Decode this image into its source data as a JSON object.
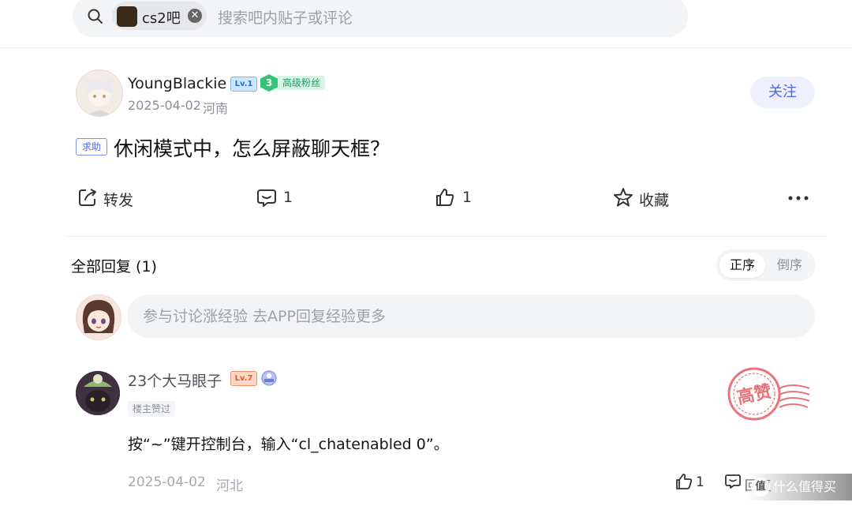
{
  "search": {
    "forum_chip": "cs2吧",
    "placeholder": "搜索吧内贴子或评论",
    "clear_glyph": "✕"
  },
  "post": {
    "author": "YoungBlackie",
    "level": "Lv.1",
    "fan_level": "3",
    "fan_title": "高级粉丝",
    "date": "2025-04-02",
    "location": "河南",
    "follow_label": "关注",
    "tag": "求助",
    "title": "休闲模式中，怎么屏蔽聊天框？",
    "actions": {
      "share_label": "转发",
      "comment_count": "1",
      "like_count": "1",
      "favorite_label": "收藏"
    }
  },
  "replies": {
    "header": "全部回复 (1)",
    "sort_options": [
      "正序",
      "倒序"
    ],
    "input_placeholder": "参与讨论涨经验 去APP回复经验更多",
    "items": [
      {
        "author": "23个大马眼子",
        "level": "Lv.7",
        "badge": "楼主赞过",
        "text": "按“~”键开控制台，输入“cl_chatenabled 0”。",
        "stamp": "高赞",
        "date": "2025-04-02",
        "location": "河北",
        "like_count": "1",
        "reply_label": "回复"
      }
    ]
  },
  "watermark": {
    "text": "什么值得买",
    "logo": "值"
  },
  "colors": {
    "accent": "#4e68e6",
    "stamp": "#e8737a",
    "fan_green": "#34c37b"
  }
}
